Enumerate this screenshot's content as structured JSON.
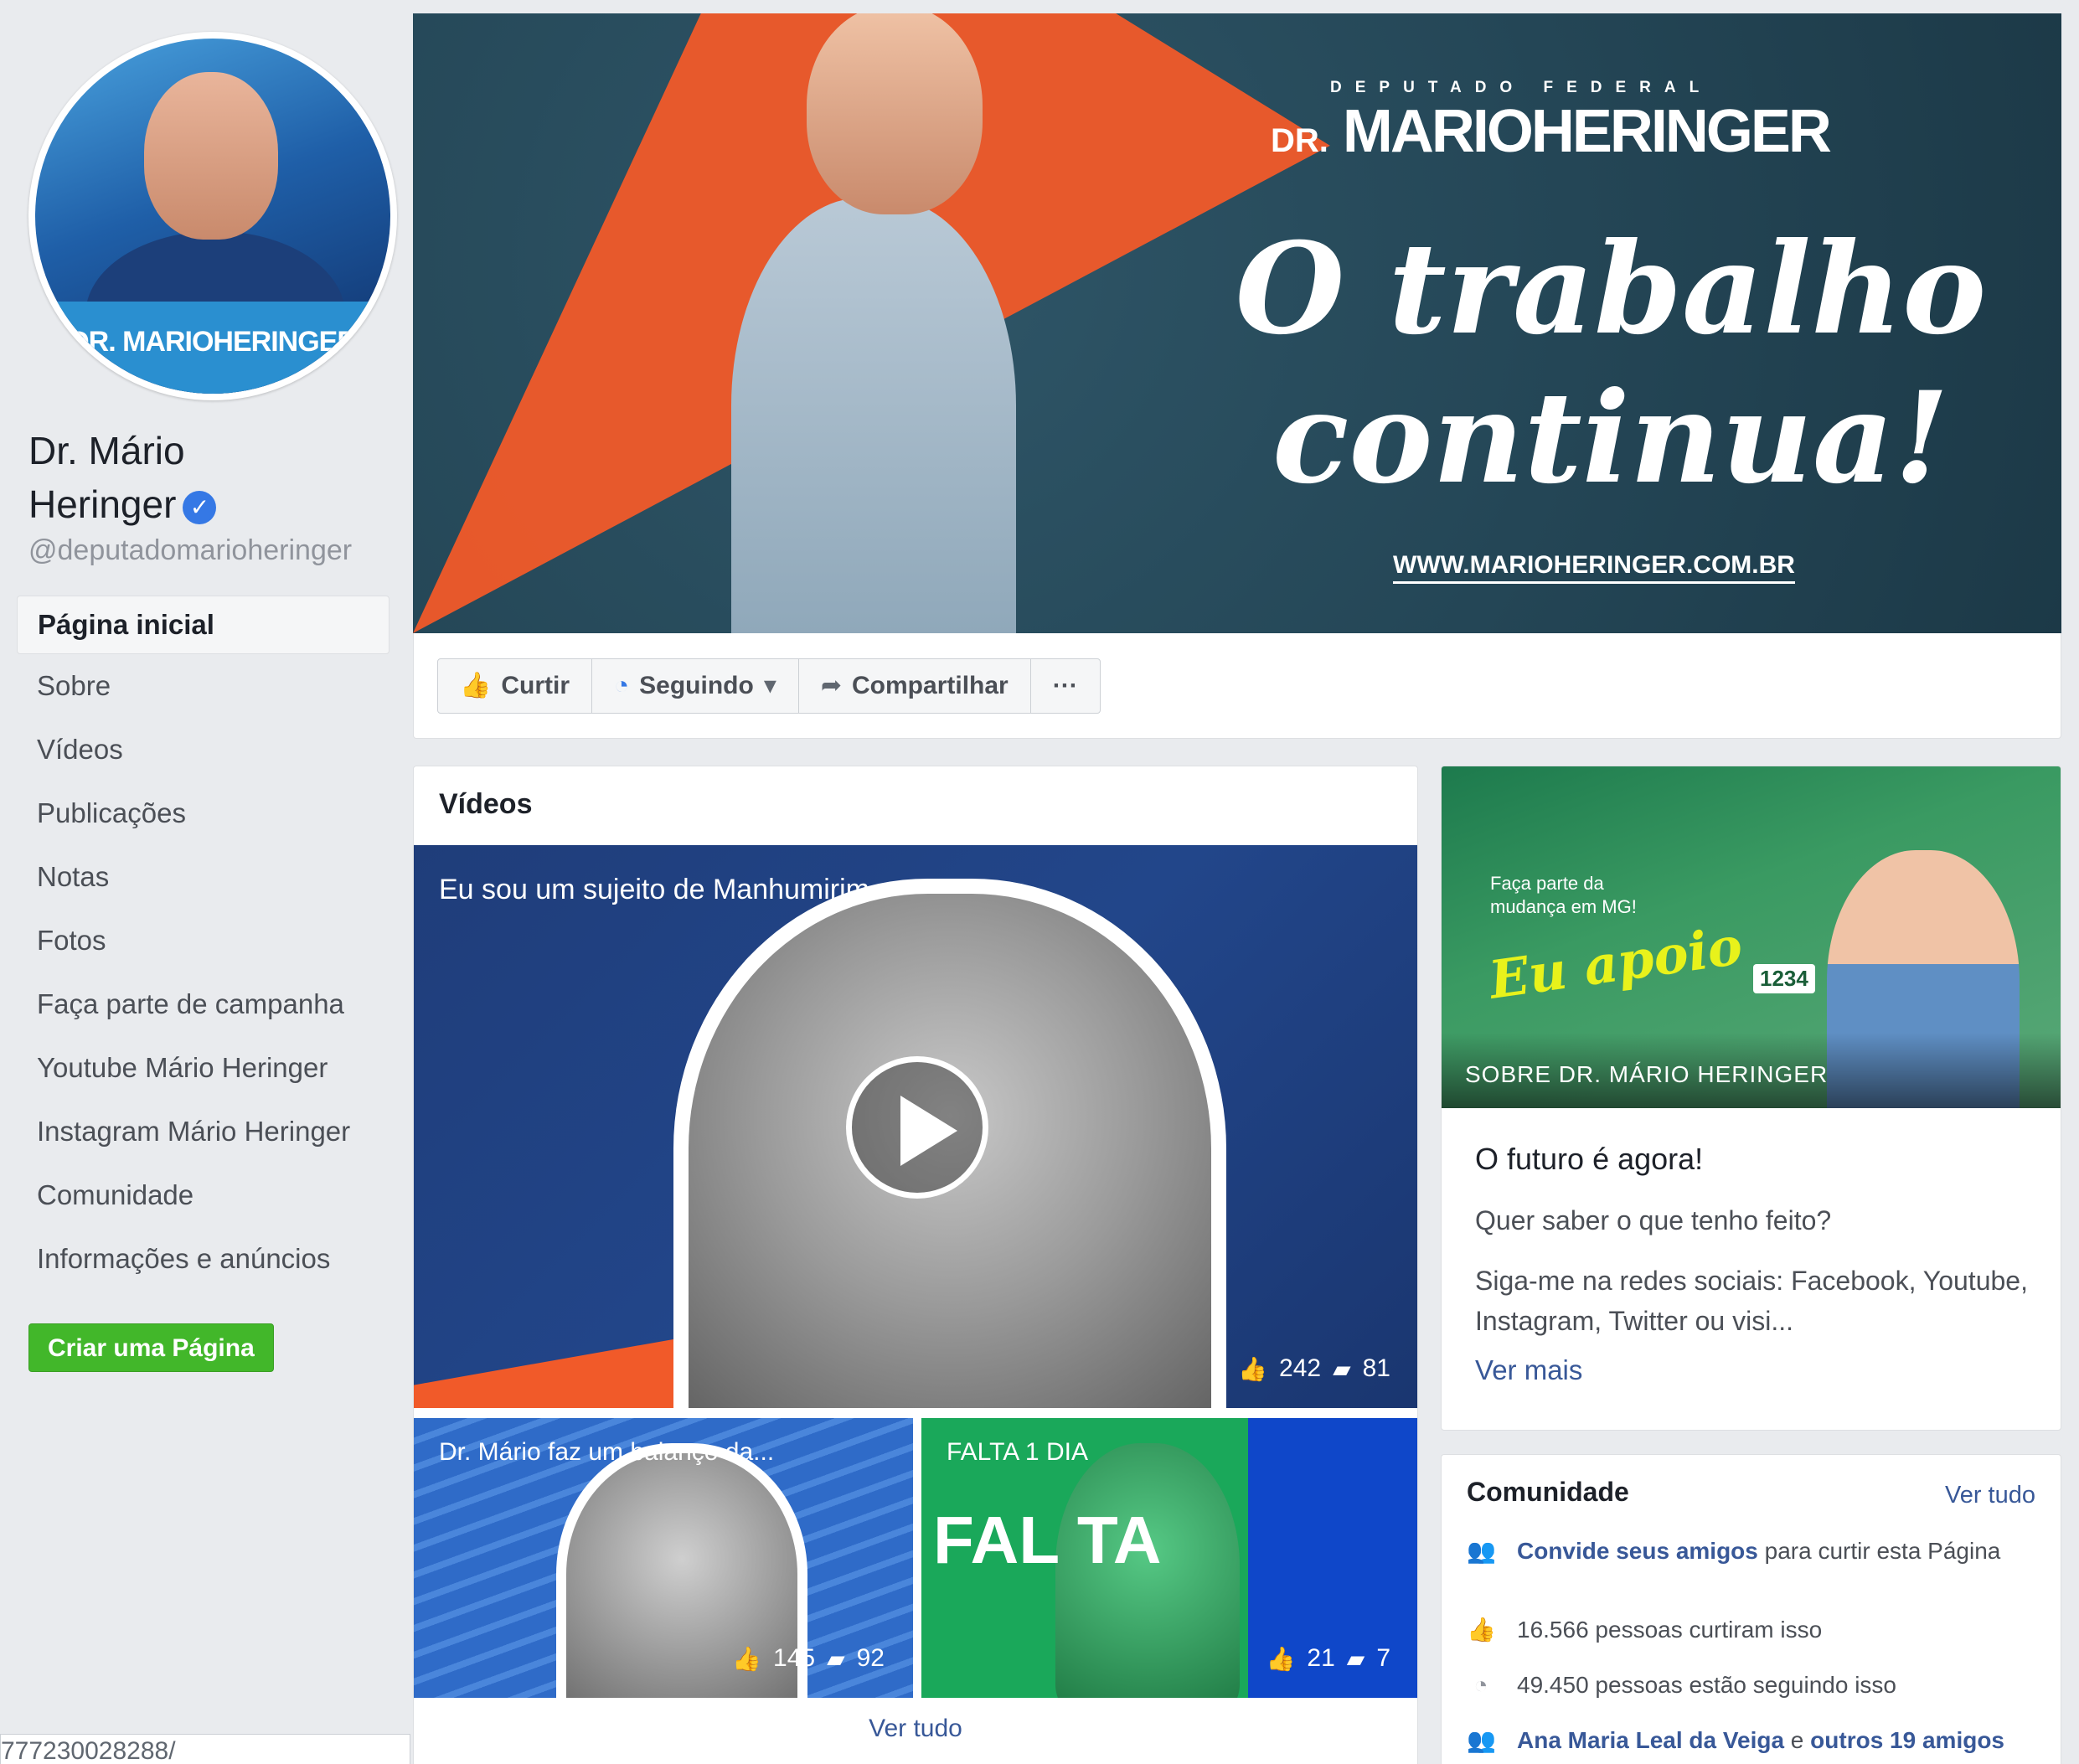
{
  "sidebar": {
    "avatar_logo": "DR. MARIOHERINGER",
    "page_name_line1": "Dr. Mário",
    "page_name_line2": "Heringer",
    "handle": "@deputadomarioheringer",
    "nav": [
      {
        "label": "Página inicial",
        "active": true
      },
      {
        "label": "Sobre"
      },
      {
        "label": "Vídeos"
      },
      {
        "label": "Publicações"
      },
      {
        "label": "Notas"
      },
      {
        "label": "Fotos"
      },
      {
        "label": "Faça parte de campanha"
      },
      {
        "label": "Youtube Mário Heringer"
      },
      {
        "label": "Instagram Mário Heringer"
      },
      {
        "label": "Comunidade"
      },
      {
        "label": "Informações e anúncios"
      }
    ],
    "create_page_button": "Criar uma Página",
    "status_url": "777230028288/"
  },
  "cover": {
    "subtitle": "DEPUTADO FEDERAL",
    "brand_prefix": "DR.",
    "brand": "MARIOHERINGER",
    "slogan_line1": "O trabalho",
    "slogan_line2": "continua!",
    "url": "WWW.MARIOHERINGER.COM.BR"
  },
  "actions": {
    "like": "Curtir",
    "following": "Seguindo",
    "share": "Compartilhar",
    "more": "···"
  },
  "videos": {
    "title": "Vídeos",
    "main": {
      "title": "Eu sou um sujeito de Manhumirim",
      "likes": "242",
      "comments": "81"
    },
    "thumb1": {
      "title": "Dr. Mário faz um balanço da...",
      "likes": "145",
      "comments": "92"
    },
    "thumb2": {
      "title": "FALTA 1 DIA",
      "big_text": "FAL TA",
      "likes": "21",
      "comments": "7"
    },
    "see_all": "Ver tudo"
  },
  "about": {
    "img_text1": "Faça parte da mudança em MG!",
    "img_text2": "Eu apoio",
    "img_badge": "1234",
    "img_caption": "SOBRE DR. MÁRIO HERINGER",
    "headline": "O futuro é agora!",
    "question": "Quer saber o que tenho feito?",
    "description": "Siga-me na redes sociais: Facebook, Youtube, Instagram, Twitter ou visi...",
    "see_more": "Ver mais"
  },
  "community": {
    "title": "Comunidade",
    "see_all": "Ver tudo",
    "invite_link": "Convide seus amigos",
    "invite_rest": " para curtir esta Página",
    "likes": "16.566 pessoas curtiram isso",
    "followers": "49.450 pessoas estão seguindo isso",
    "friends_a": "Ana Maria Leal da Veiga",
    "friends_mid": " e ",
    "friends_b": "outros 19 amigos"
  },
  "colors": {
    "accent_blue": "#385898",
    "create_green": "#42b72a",
    "verified_blue": "#3578e5",
    "cover_orange": "#f15a29"
  }
}
